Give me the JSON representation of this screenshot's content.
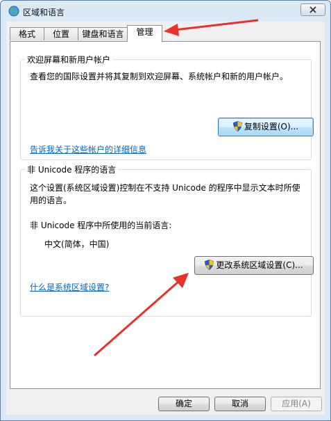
{
  "window": {
    "title": "区域和语言",
    "icon": "globe-icon",
    "close_icon": "close-icon"
  },
  "tabs": [
    {
      "label": "格式",
      "active": false
    },
    {
      "label": "位置",
      "active": false
    },
    {
      "label": "键盘和语言",
      "active": false
    },
    {
      "label": "管理",
      "active": true
    }
  ],
  "welcome_group": {
    "title": "欢迎屏幕和新用户帐户",
    "description": "查看您的国际设置并将其复制到欢迎屏幕、系统帐户和新的用户帐户。",
    "copy_button": "复制设置(O)...",
    "link": "告诉我关于这些帐户的详细信息"
  },
  "unicode_group": {
    "title": "非 Unicode 程序的语言",
    "description_line1": "这个设置(系统区域设置)控制在不支持 Unicode 的程序中显示文本时所使",
    "description_line2": "用的语言。",
    "current_label": "非 Unicode 程序中所使用的当前语言:",
    "current_value": "中文(简体，中国)",
    "change_button": "更改系统区域设置(C)...",
    "link": "什么是系统区域设置?"
  },
  "footer": {
    "ok": "确定",
    "cancel": "取消",
    "apply": "应用(A)"
  },
  "colors": {
    "annotation_arrow": "#e8302c",
    "link": "#0066cc",
    "focus_border": "#3c7fb1"
  }
}
